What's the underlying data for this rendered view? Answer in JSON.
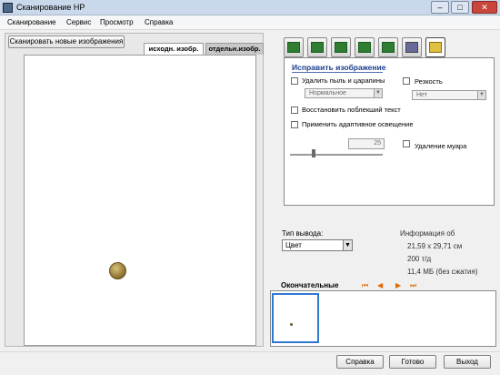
{
  "window": {
    "title": "Сканирование HP"
  },
  "menu": [
    "Сканирование",
    "Сервис",
    "Просмотр",
    "Справка"
  ],
  "left": {
    "scan_button": "Сканировать новые изображения",
    "tabs": [
      "исходн. изобр.",
      "отдельн.изобр."
    ]
  },
  "panel": {
    "title": "Исправить изображение",
    "dust_label": "Удалить пыль и царапины",
    "dust_value": "Нормальное",
    "sharp_label": "Резкость",
    "sharp_value": "Нет",
    "restore_label": "Восстановить поблекший текст",
    "adaptive_label": "Применить адаптивное освещение",
    "adaptive_value": "25",
    "moire_label": "Удаление муара"
  },
  "output": {
    "type_label": "Тип вывода:",
    "type_value": "Цвет",
    "info_label": "Информация об",
    "size": "21,59 x 29,71 см",
    "dpi": "200 т/д",
    "filesize": "11,4 МБ (без сжатия)"
  },
  "final": {
    "label": "Окончательные"
  },
  "buttons": {
    "help": "Справка",
    "done": "Готово",
    "exit": "Выход"
  },
  "colors": {
    "accent": "#1a3d8f",
    "thumb_border": "#2f78d0"
  }
}
